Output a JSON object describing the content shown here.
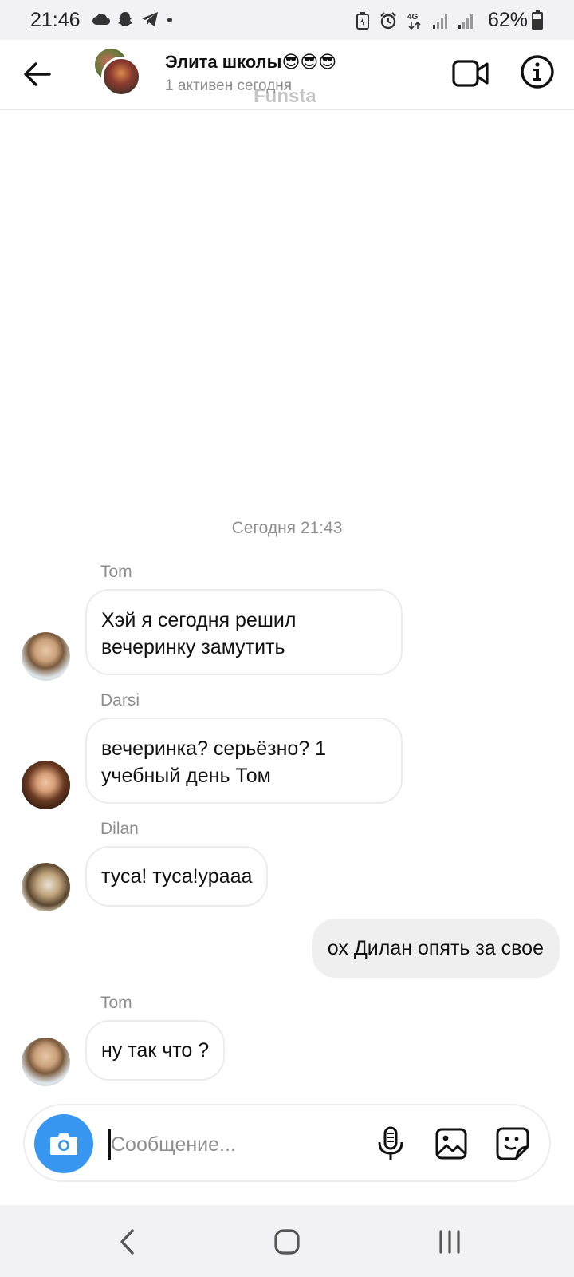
{
  "status_bar": {
    "time": "21:46",
    "left_icons": [
      "cloud-icon",
      "snapchat-icon",
      "telegram-icon",
      "dot-icon"
    ],
    "right_icons": [
      "battery-saver-icon",
      "alarm-icon",
      "4g-icon",
      "signal-icon",
      "signal-icon"
    ],
    "battery_percent": "62%",
    "battery_level": 0.62
  },
  "header": {
    "title": "Элита школы😎😎😎",
    "subtitle": "1 активен сегодня",
    "watermark": "Funsta",
    "back_icon": "arrow-left-icon",
    "video_icon": "video-camera-icon",
    "info_icon": "info-icon"
  },
  "chat": {
    "date_separator": "Сегодня 21:43",
    "messages": [
      {
        "sender": "Tom",
        "text": "Хэй я сегодня решил вечеринку замутить",
        "direction": "incoming"
      },
      {
        "sender": "Darsi",
        "text": "вечеринка? серьёзно? 1 учебный день Том",
        "direction": "incoming"
      },
      {
        "sender": "Dilan",
        "text": "туса! туса!урааа",
        "direction": "incoming"
      },
      {
        "sender": "",
        "text": "ох Дилан опять за свое",
        "direction": "outgoing"
      },
      {
        "sender": "Tom",
        "text": "ну так что ?",
        "direction": "incoming"
      }
    ]
  },
  "composer": {
    "placeholder": "Сообщение...",
    "value": "",
    "camera_icon": "camera-icon",
    "mic_icon": "microphone-icon",
    "gallery_icon": "image-icon",
    "sticker_icon": "sticker-icon",
    "accent_color": "#3797f0"
  },
  "nav_bar": {
    "back_icon": "nav-back-icon",
    "home_icon": "nav-home-icon",
    "recents_icon": "nav-recents-icon"
  }
}
